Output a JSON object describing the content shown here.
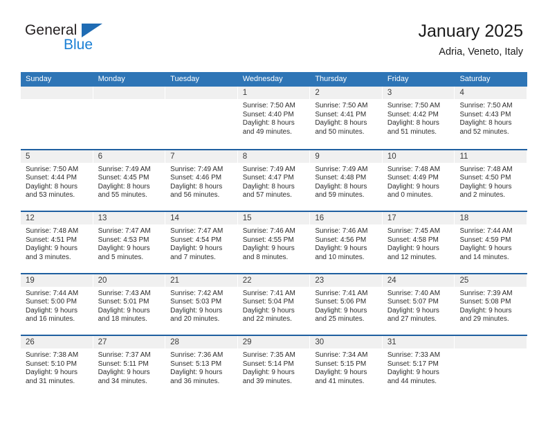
{
  "brand": {
    "name_part1": "General",
    "name_part2": "Blue",
    "logo_icon": "triangle-logo-icon"
  },
  "header": {
    "title": "January 2025",
    "subtitle": "Adria, Veneto, Italy"
  },
  "colors": {
    "header_blue": "#2e75b6",
    "row_divider_blue": "#1f5fa0",
    "day_band_gray": "#f0f0f0",
    "brand_blue": "#1a7fd4",
    "text_dark": "#1a1a1a"
  },
  "weekdays": [
    "Sunday",
    "Monday",
    "Tuesday",
    "Wednesday",
    "Thursday",
    "Friday",
    "Saturday"
  ],
  "weeks": [
    [
      {
        "day": "",
        "empty": true,
        "sunrise": "",
        "sunset": "",
        "daylight_line1": "",
        "daylight_line2": ""
      },
      {
        "day": "",
        "empty": true,
        "sunrise": "",
        "sunset": "",
        "daylight_line1": "",
        "daylight_line2": ""
      },
      {
        "day": "",
        "empty": true,
        "sunrise": "",
        "sunset": "",
        "daylight_line1": "",
        "daylight_line2": ""
      },
      {
        "day": "1",
        "empty": false,
        "sunrise": "Sunrise: 7:50 AM",
        "sunset": "Sunset: 4:40 PM",
        "daylight_line1": "Daylight: 8 hours",
        "daylight_line2": "and 49 minutes."
      },
      {
        "day": "2",
        "empty": false,
        "sunrise": "Sunrise: 7:50 AM",
        "sunset": "Sunset: 4:41 PM",
        "daylight_line1": "Daylight: 8 hours",
        "daylight_line2": "and 50 minutes."
      },
      {
        "day": "3",
        "empty": false,
        "sunrise": "Sunrise: 7:50 AM",
        "sunset": "Sunset: 4:42 PM",
        "daylight_line1": "Daylight: 8 hours",
        "daylight_line2": "and 51 minutes."
      },
      {
        "day": "4",
        "empty": false,
        "sunrise": "Sunrise: 7:50 AM",
        "sunset": "Sunset: 4:43 PM",
        "daylight_line1": "Daylight: 8 hours",
        "daylight_line2": "and 52 minutes."
      }
    ],
    [
      {
        "day": "5",
        "empty": false,
        "sunrise": "Sunrise: 7:50 AM",
        "sunset": "Sunset: 4:44 PM",
        "daylight_line1": "Daylight: 8 hours",
        "daylight_line2": "and 53 minutes."
      },
      {
        "day": "6",
        "empty": false,
        "sunrise": "Sunrise: 7:49 AM",
        "sunset": "Sunset: 4:45 PM",
        "daylight_line1": "Daylight: 8 hours",
        "daylight_line2": "and 55 minutes."
      },
      {
        "day": "7",
        "empty": false,
        "sunrise": "Sunrise: 7:49 AM",
        "sunset": "Sunset: 4:46 PM",
        "daylight_line1": "Daylight: 8 hours",
        "daylight_line2": "and 56 minutes."
      },
      {
        "day": "8",
        "empty": false,
        "sunrise": "Sunrise: 7:49 AM",
        "sunset": "Sunset: 4:47 PM",
        "daylight_line1": "Daylight: 8 hours",
        "daylight_line2": "and 57 minutes."
      },
      {
        "day": "9",
        "empty": false,
        "sunrise": "Sunrise: 7:49 AM",
        "sunset": "Sunset: 4:48 PM",
        "daylight_line1": "Daylight: 8 hours",
        "daylight_line2": "and 59 minutes."
      },
      {
        "day": "10",
        "empty": false,
        "sunrise": "Sunrise: 7:48 AM",
        "sunset": "Sunset: 4:49 PM",
        "daylight_line1": "Daylight: 9 hours",
        "daylight_line2": "and 0 minutes."
      },
      {
        "day": "11",
        "empty": false,
        "sunrise": "Sunrise: 7:48 AM",
        "sunset": "Sunset: 4:50 PM",
        "daylight_line1": "Daylight: 9 hours",
        "daylight_line2": "and 2 minutes."
      }
    ],
    [
      {
        "day": "12",
        "empty": false,
        "sunrise": "Sunrise: 7:48 AM",
        "sunset": "Sunset: 4:51 PM",
        "daylight_line1": "Daylight: 9 hours",
        "daylight_line2": "and 3 minutes."
      },
      {
        "day": "13",
        "empty": false,
        "sunrise": "Sunrise: 7:47 AM",
        "sunset": "Sunset: 4:53 PM",
        "daylight_line1": "Daylight: 9 hours",
        "daylight_line2": "and 5 minutes."
      },
      {
        "day": "14",
        "empty": false,
        "sunrise": "Sunrise: 7:47 AM",
        "sunset": "Sunset: 4:54 PM",
        "daylight_line1": "Daylight: 9 hours",
        "daylight_line2": "and 7 minutes."
      },
      {
        "day": "15",
        "empty": false,
        "sunrise": "Sunrise: 7:46 AM",
        "sunset": "Sunset: 4:55 PM",
        "daylight_line1": "Daylight: 9 hours",
        "daylight_line2": "and 8 minutes."
      },
      {
        "day": "16",
        "empty": false,
        "sunrise": "Sunrise: 7:46 AM",
        "sunset": "Sunset: 4:56 PM",
        "daylight_line1": "Daylight: 9 hours",
        "daylight_line2": "and 10 minutes."
      },
      {
        "day": "17",
        "empty": false,
        "sunrise": "Sunrise: 7:45 AM",
        "sunset": "Sunset: 4:58 PM",
        "daylight_line1": "Daylight: 9 hours",
        "daylight_line2": "and 12 minutes."
      },
      {
        "day": "18",
        "empty": false,
        "sunrise": "Sunrise: 7:44 AM",
        "sunset": "Sunset: 4:59 PM",
        "daylight_line1": "Daylight: 9 hours",
        "daylight_line2": "and 14 minutes."
      }
    ],
    [
      {
        "day": "19",
        "empty": false,
        "sunrise": "Sunrise: 7:44 AM",
        "sunset": "Sunset: 5:00 PM",
        "daylight_line1": "Daylight: 9 hours",
        "daylight_line2": "and 16 minutes."
      },
      {
        "day": "20",
        "empty": false,
        "sunrise": "Sunrise: 7:43 AM",
        "sunset": "Sunset: 5:01 PM",
        "daylight_line1": "Daylight: 9 hours",
        "daylight_line2": "and 18 minutes."
      },
      {
        "day": "21",
        "empty": false,
        "sunrise": "Sunrise: 7:42 AM",
        "sunset": "Sunset: 5:03 PM",
        "daylight_line1": "Daylight: 9 hours",
        "daylight_line2": "and 20 minutes."
      },
      {
        "day": "22",
        "empty": false,
        "sunrise": "Sunrise: 7:41 AM",
        "sunset": "Sunset: 5:04 PM",
        "daylight_line1": "Daylight: 9 hours",
        "daylight_line2": "and 22 minutes."
      },
      {
        "day": "23",
        "empty": false,
        "sunrise": "Sunrise: 7:41 AM",
        "sunset": "Sunset: 5:06 PM",
        "daylight_line1": "Daylight: 9 hours",
        "daylight_line2": "and 25 minutes."
      },
      {
        "day": "24",
        "empty": false,
        "sunrise": "Sunrise: 7:40 AM",
        "sunset": "Sunset: 5:07 PM",
        "daylight_line1": "Daylight: 9 hours",
        "daylight_line2": "and 27 minutes."
      },
      {
        "day": "25",
        "empty": false,
        "sunrise": "Sunrise: 7:39 AM",
        "sunset": "Sunset: 5:08 PM",
        "daylight_line1": "Daylight: 9 hours",
        "daylight_line2": "and 29 minutes."
      }
    ],
    [
      {
        "day": "26",
        "empty": false,
        "sunrise": "Sunrise: 7:38 AM",
        "sunset": "Sunset: 5:10 PM",
        "daylight_line1": "Daylight: 9 hours",
        "daylight_line2": "and 31 minutes."
      },
      {
        "day": "27",
        "empty": false,
        "sunrise": "Sunrise: 7:37 AM",
        "sunset": "Sunset: 5:11 PM",
        "daylight_line1": "Daylight: 9 hours",
        "daylight_line2": "and 34 minutes."
      },
      {
        "day": "28",
        "empty": false,
        "sunrise": "Sunrise: 7:36 AM",
        "sunset": "Sunset: 5:13 PM",
        "daylight_line1": "Daylight: 9 hours",
        "daylight_line2": "and 36 minutes."
      },
      {
        "day": "29",
        "empty": false,
        "sunrise": "Sunrise: 7:35 AM",
        "sunset": "Sunset: 5:14 PM",
        "daylight_line1": "Daylight: 9 hours",
        "daylight_line2": "and 39 minutes."
      },
      {
        "day": "30",
        "empty": false,
        "sunrise": "Sunrise: 7:34 AM",
        "sunset": "Sunset: 5:15 PM",
        "daylight_line1": "Daylight: 9 hours",
        "daylight_line2": "and 41 minutes."
      },
      {
        "day": "31",
        "empty": false,
        "sunrise": "Sunrise: 7:33 AM",
        "sunset": "Sunset: 5:17 PM",
        "daylight_line1": "Daylight: 9 hours",
        "daylight_line2": "and 44 minutes."
      },
      {
        "day": "",
        "empty": true,
        "sunrise": "",
        "sunset": "",
        "daylight_line1": "",
        "daylight_line2": ""
      }
    ]
  ]
}
